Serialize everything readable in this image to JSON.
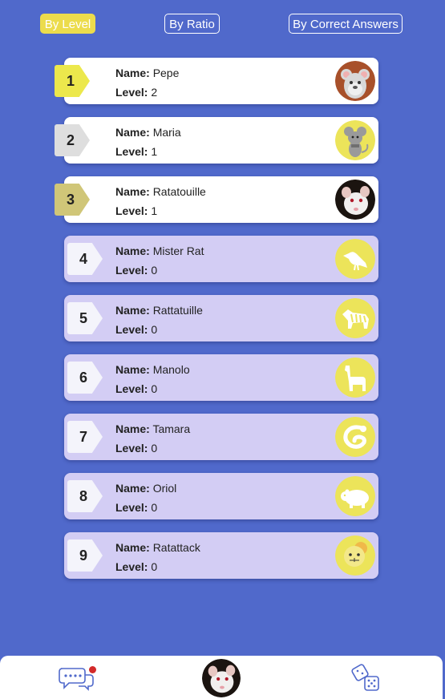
{
  "filters": {
    "by_level": "By Level",
    "by_ratio": "By Ratio",
    "by_correct": "By Correct Answers"
  },
  "labels": {
    "name": "Name:",
    "level": "Level:"
  },
  "ranking": [
    {
      "rank": "1",
      "name": "Pepe",
      "level": "2",
      "badge_color": "#ece84c",
      "avatar": "hamster-icon"
    },
    {
      "rank": "2",
      "name": "Maria",
      "level": "1",
      "badge_color": "#dedede",
      "avatar": "mouse-icon"
    },
    {
      "rank": "3",
      "name": "Ratatouille",
      "level": "1",
      "badge_color": "#d0c678",
      "avatar": "rat-photo"
    },
    {
      "rank": "4",
      "name": "Mister Rat",
      "level": "0",
      "avatar": "bird-icon"
    },
    {
      "rank": "5",
      "name": "Rattatuille",
      "level": "0",
      "avatar": "zebra-icon"
    },
    {
      "rank": "6",
      "name": "Manolo",
      "level": "0",
      "avatar": "llama-icon"
    },
    {
      "rank": "7",
      "name": "Tamara",
      "level": "0",
      "avatar": "snake-icon"
    },
    {
      "rank": "8",
      "name": "Oriol",
      "level": "0",
      "avatar": "hippo-icon"
    },
    {
      "rank": "9",
      "name": "Ratattack",
      "level": "0",
      "avatar": "mouse-face-icon"
    }
  ],
  "colors": {
    "background": "#5069cb",
    "accent_yellow": "#ecdc4c",
    "card_rest": "#d3cdf4",
    "notification_dot": "#d32a2a"
  },
  "bottom_nav": {
    "chat": "chat-icon",
    "profile": "rat-photo",
    "dice": "dice-icon"
  }
}
